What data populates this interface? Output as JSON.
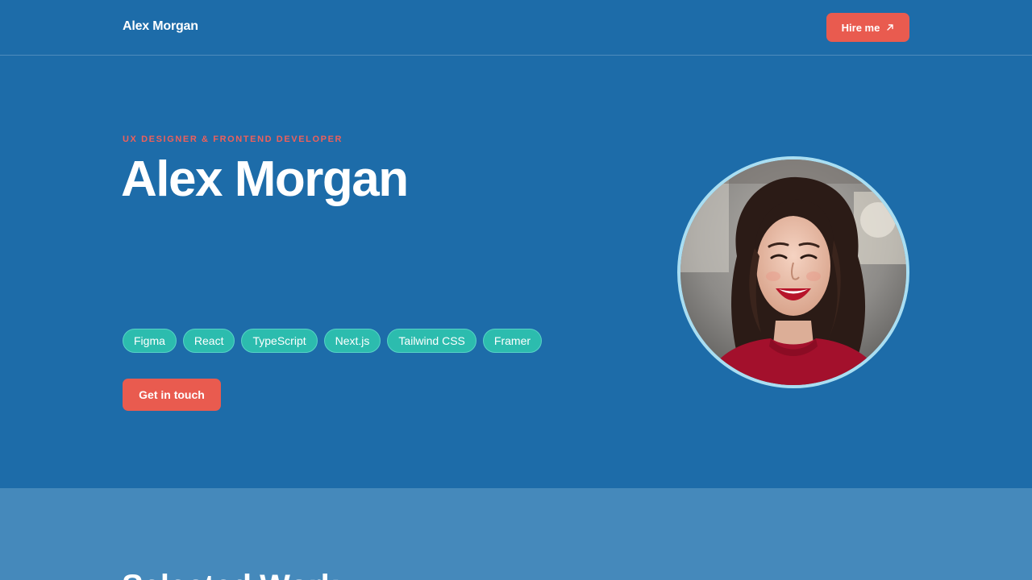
{
  "header": {
    "brand": "Alex Morgan",
    "hire_label": "Hire me",
    "hire_icon": "arrow-up-right-icon"
  },
  "hero": {
    "eyebrow": "UX DESIGNER & FRONTEND DEVELOPER",
    "title": "Alex Morgan",
    "tags": [
      "Figma",
      "React",
      "TypeScript",
      "Next.js",
      "Tailwind CSS",
      "Framer"
    ],
    "cta_label": "Get in touch",
    "avatar": "portrait-photo"
  },
  "work": {
    "title": "Selected Work"
  },
  "colors": {
    "background": "#1d6ca9",
    "accent": "#e95b4f",
    "tag": "#2cbcae",
    "section_alt": "#4589bb",
    "avatar_ring": "#a9def2"
  }
}
